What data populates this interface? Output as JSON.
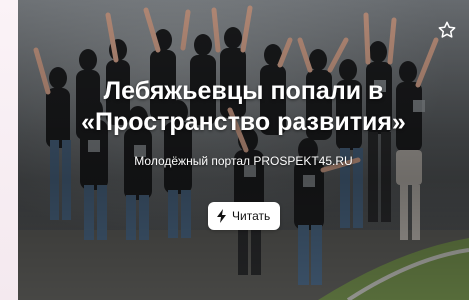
{
  "card": {
    "title": "Лебяжьевцы попали в «Пространство развития»",
    "source": "Молодёжный портал PROSPEKT45.RU",
    "read_button_label": "Читать",
    "read_button_icon": "lightning-icon",
    "favorite_icon": "star-outline-icon"
  },
  "colors": {
    "text": "#ffffff",
    "button_bg": "#ffffff",
    "button_text": "#111111"
  }
}
